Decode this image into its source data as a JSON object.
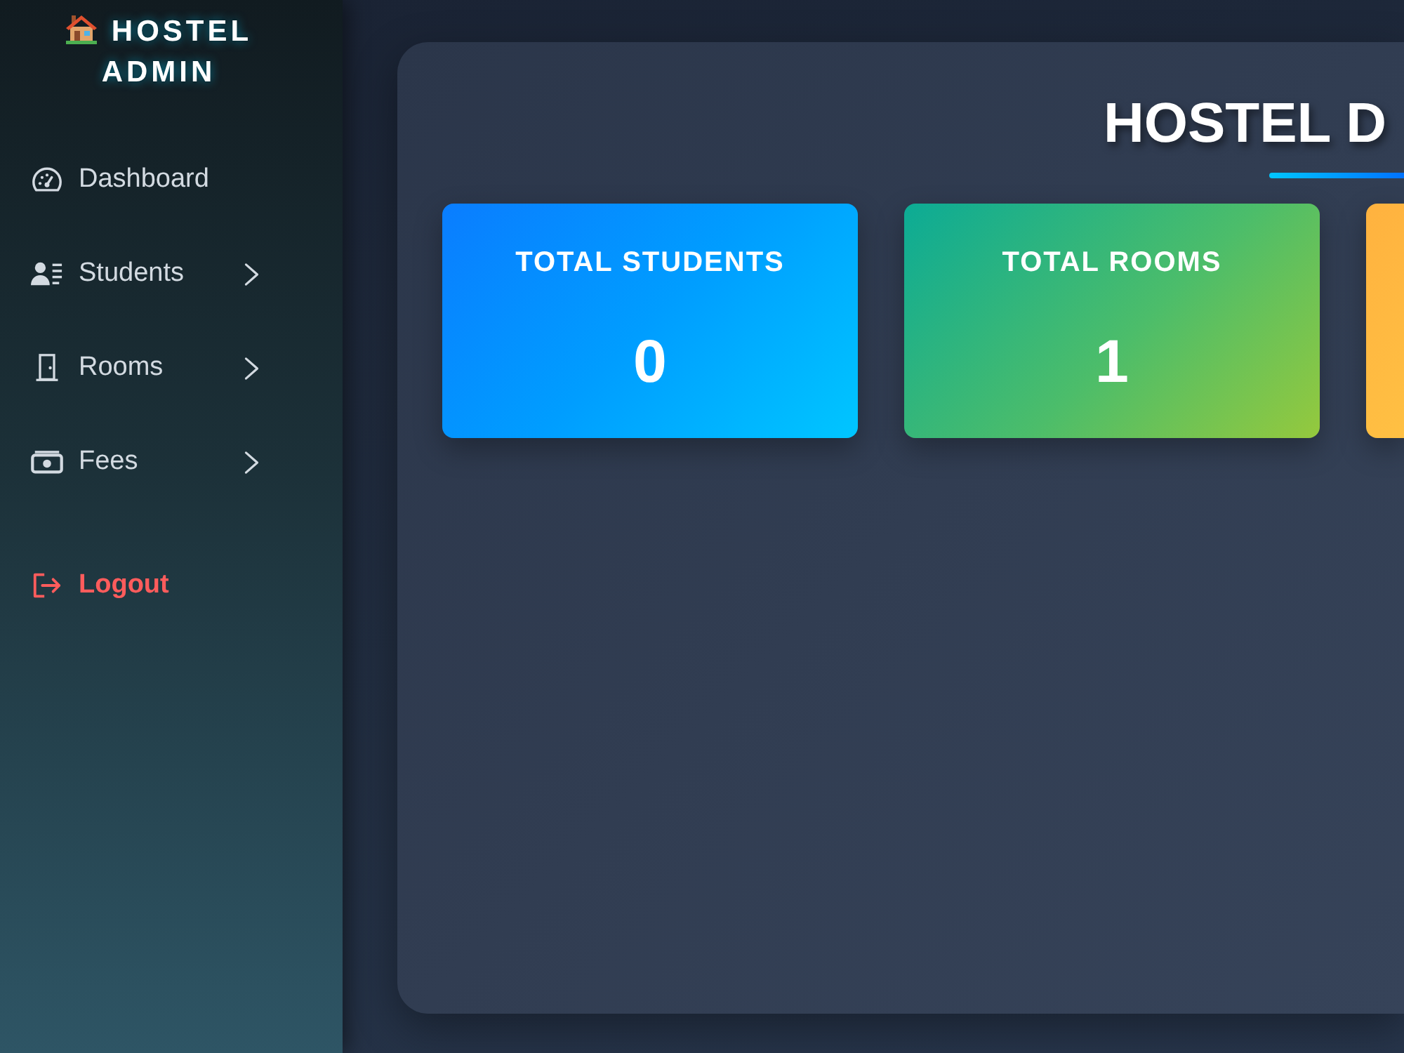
{
  "sidebar": {
    "brand": "HOSTEL ADMIN",
    "items": [
      {
        "kind": "link",
        "label": "Dashboard"
      },
      {
        "kind": "submenu",
        "label": "Students"
      },
      {
        "kind": "submenu",
        "label": "Rooms"
      },
      {
        "kind": "submenu",
        "label": "Fees"
      },
      {
        "kind": "logout",
        "label": "Logout"
      }
    ]
  },
  "main": {
    "title": "HOSTEL D",
    "cards": [
      {
        "kind": "primary",
        "label": "TOTAL STUDENTS",
        "value": "0"
      },
      {
        "kind": "success",
        "label": "TOTAL ROOMS",
        "value": "1"
      },
      {
        "kind": "warning"
      }
    ]
  }
}
